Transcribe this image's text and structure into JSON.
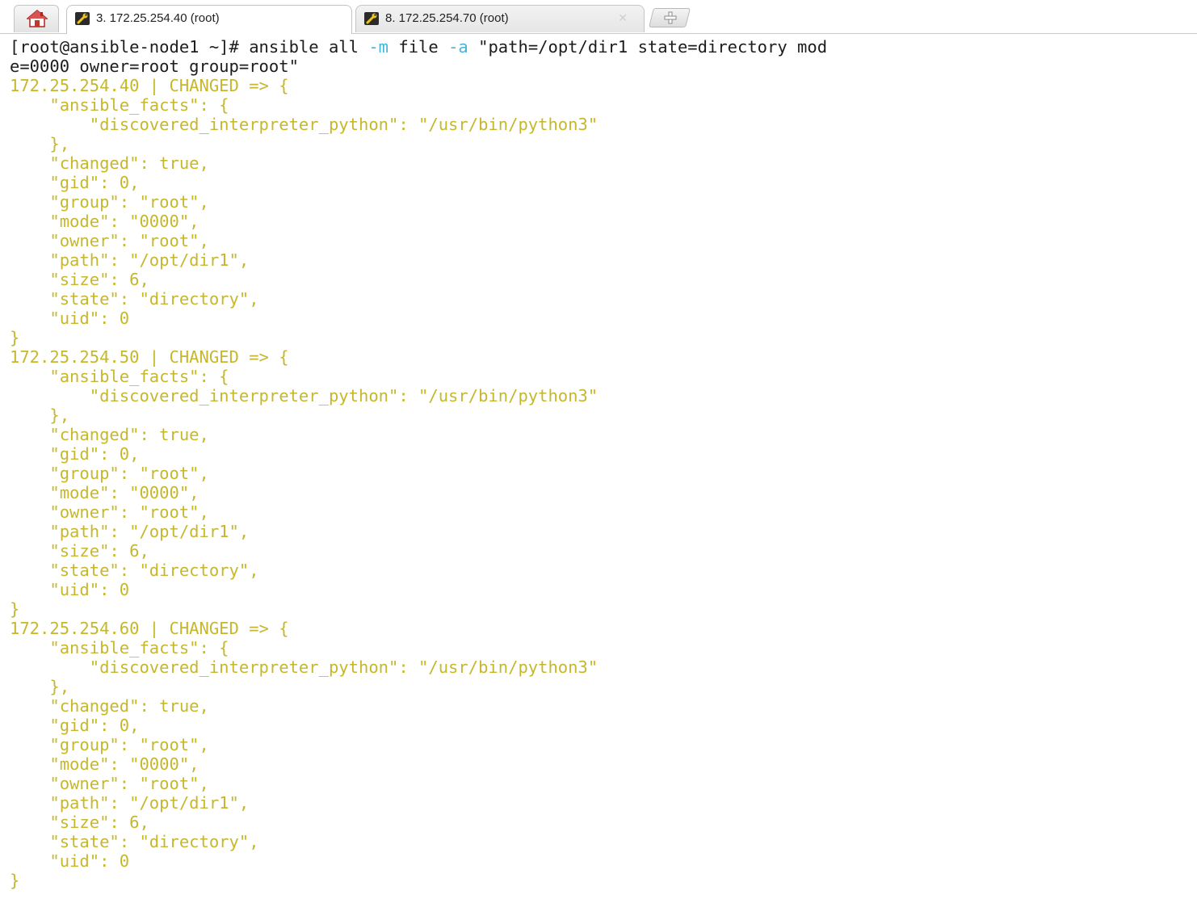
{
  "tabs": [
    {
      "label": "3. 172.25.254.40 (root)",
      "active": true
    },
    {
      "label": "8. 172.25.254.70 (root)",
      "active": false
    }
  ],
  "tab_close_glyph": "✕",
  "colors": {
    "output_text": "#c6b72c",
    "command_text": "#1c1c1c",
    "option_flag": "#45b5d8",
    "home_icon": "#d9534f"
  },
  "terminal": {
    "prompt": "[root@ansible-node1 ~]# ",
    "cmd_part1": "ansible all ",
    "opt_m": "-m",
    "cmd_part2": " file ",
    "opt_a": "-a",
    "cmd_part3": " \"path=/opt/dir1 state=directory mod",
    "cmd_wrap": "e=0000 owner=root group=root\"",
    "blocks": [
      {
        "header": "172.25.254.40 | CHANGED => {",
        "lines": [
          "    \"ansible_facts\": {",
          "        \"discovered_interpreter_python\": \"/usr/bin/python3\"",
          "    },",
          "    \"changed\": true,",
          "    \"gid\": 0,",
          "    \"group\": \"root\",",
          "    \"mode\": \"0000\",",
          "    \"owner\": \"root\",",
          "    \"path\": \"/opt/dir1\",",
          "    \"size\": 6,",
          "    \"state\": \"directory\",",
          "    \"uid\": 0",
          "}"
        ]
      },
      {
        "header": "172.25.254.50 | CHANGED => {",
        "lines": [
          "    \"ansible_facts\": {",
          "        \"discovered_interpreter_python\": \"/usr/bin/python3\"",
          "    },",
          "    \"changed\": true,",
          "    \"gid\": 0,",
          "    \"group\": \"root\",",
          "    \"mode\": \"0000\",",
          "    \"owner\": \"root\",",
          "    \"path\": \"/opt/dir1\",",
          "    \"size\": 6,",
          "    \"state\": \"directory\",",
          "    \"uid\": 0",
          "}"
        ]
      },
      {
        "header": "172.25.254.60 | CHANGED => {",
        "lines": [
          "    \"ansible_facts\": {",
          "        \"discovered_interpreter_python\": \"/usr/bin/python3\"",
          "    },",
          "    \"changed\": true,",
          "    \"gid\": 0,",
          "    \"group\": \"root\",",
          "    \"mode\": \"0000\",",
          "    \"owner\": \"root\",",
          "    \"path\": \"/opt/dir1\",",
          "    \"size\": 6,",
          "    \"state\": \"directory\",",
          "    \"uid\": 0",
          "}"
        ]
      }
    ]
  }
}
